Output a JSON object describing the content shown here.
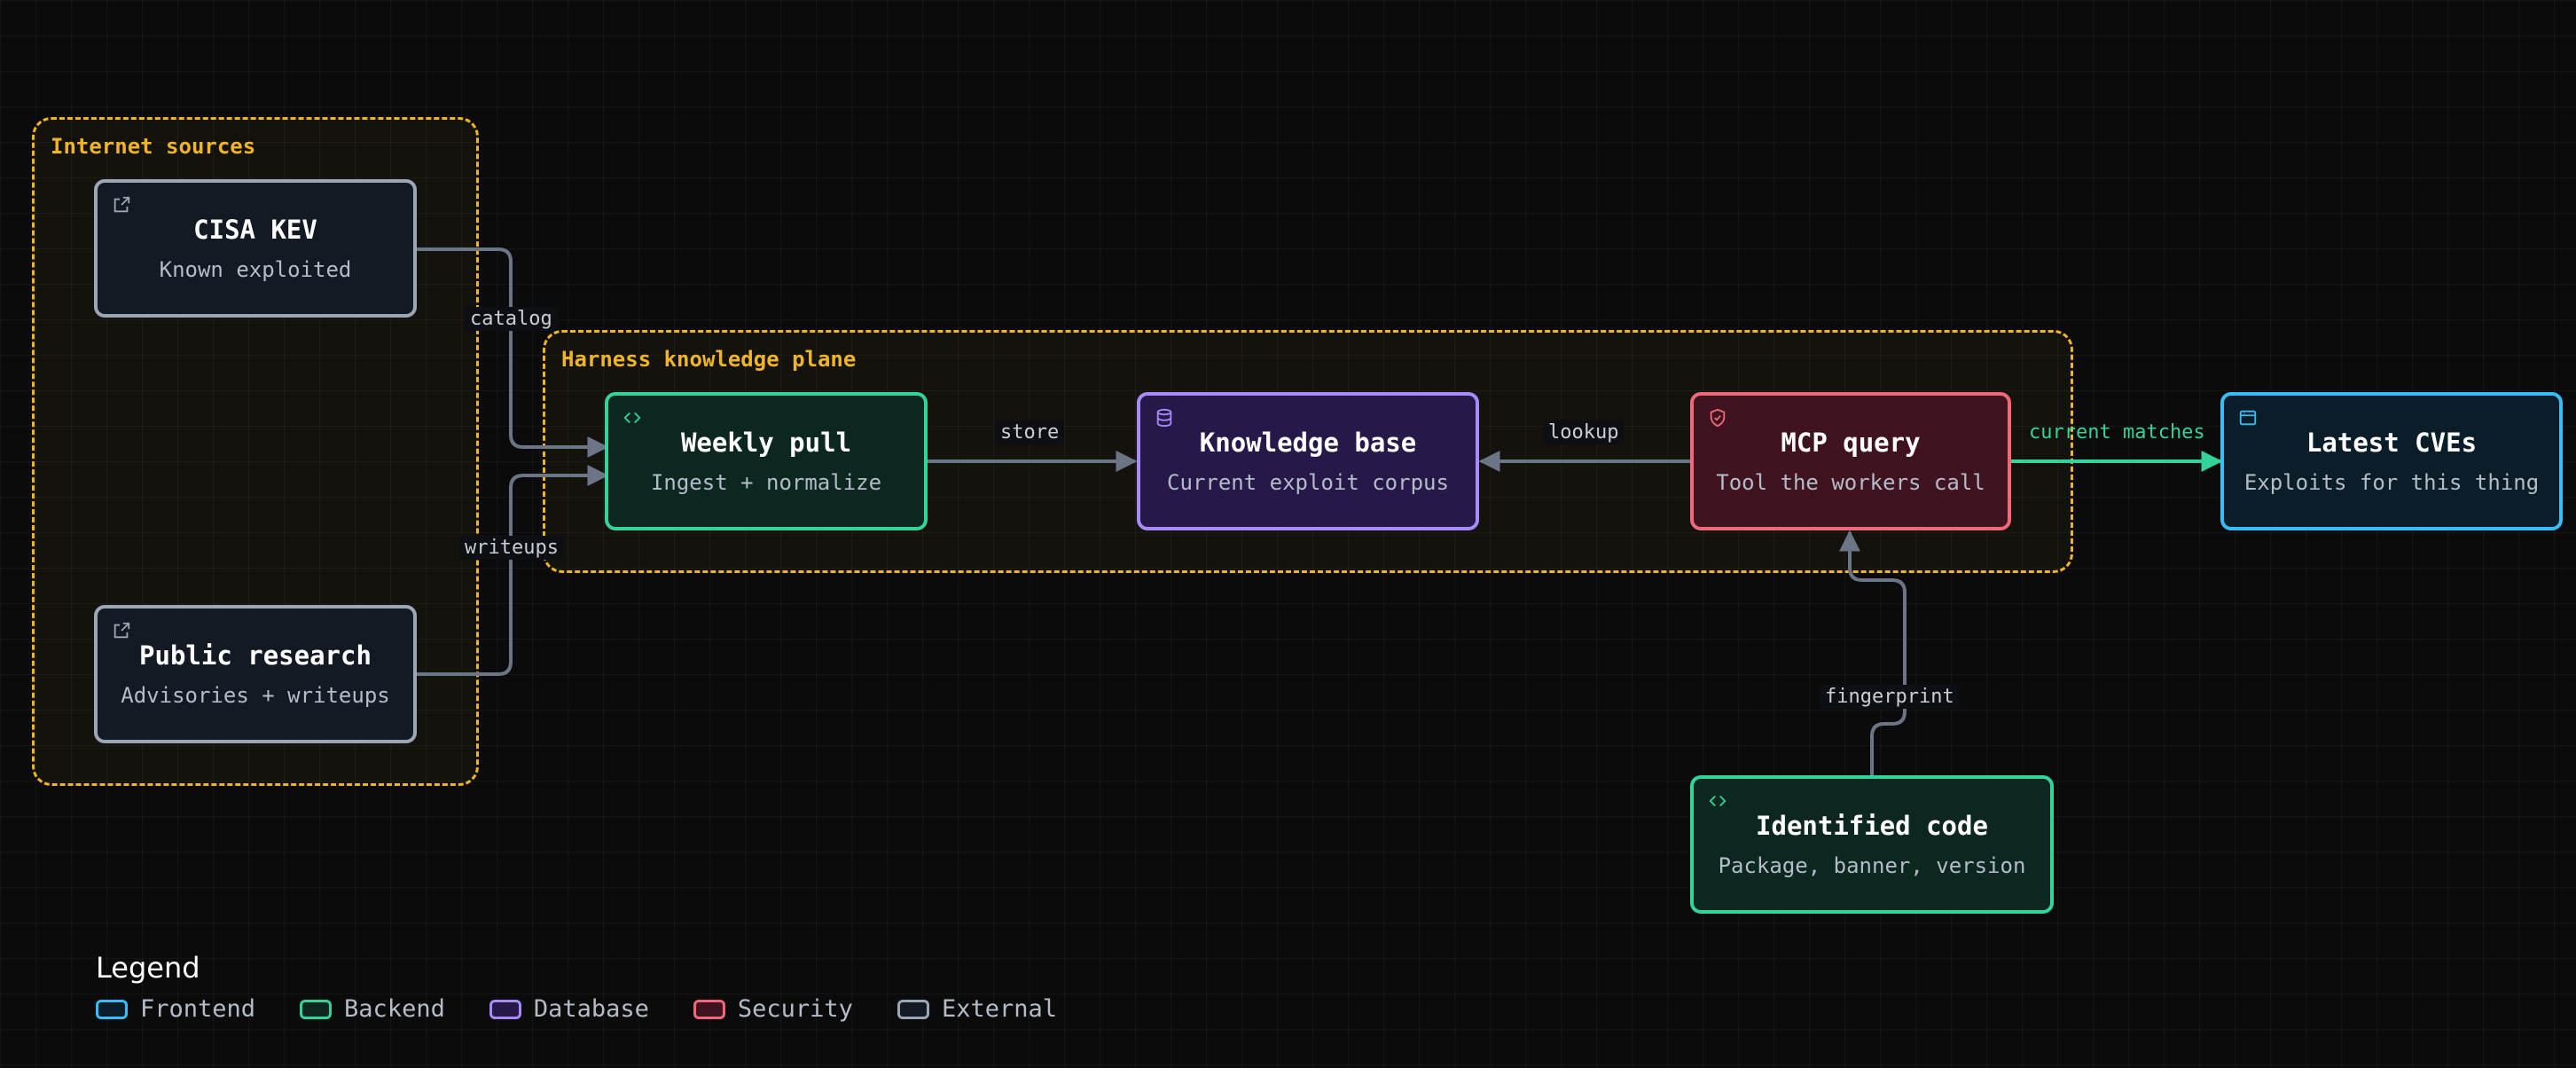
{
  "groups": {
    "internet_sources": {
      "label": "Internet sources"
    },
    "knowledge_plane": {
      "label": "Harness knowledge plane"
    }
  },
  "nodes": {
    "cisa_kev": {
      "title": "CISA KEV",
      "subtitle": "Known exploited",
      "icon": "external-link-icon"
    },
    "public_research": {
      "title": "Public research",
      "subtitle": "Advisories + writeups",
      "icon": "external-link-icon"
    },
    "weekly_pull": {
      "title": "Weekly pull",
      "subtitle": "Ingest + normalize",
      "icon": "code-icon"
    },
    "knowledge_base": {
      "title": "Knowledge base",
      "subtitle": "Current exploit corpus",
      "icon": "database-icon"
    },
    "mcp_query": {
      "title": "MCP query",
      "subtitle": "Tool the workers call",
      "icon": "shield-check-icon"
    },
    "latest_cves": {
      "title": "Latest CVEs",
      "subtitle": "Exploits for this thing",
      "icon": "browser-window-icon"
    },
    "identified_code": {
      "title": "Identified code",
      "subtitle": "Package, banner, version",
      "icon": "code-icon"
    }
  },
  "edges": {
    "catalog": "catalog",
    "writeups": "writeups",
    "store": "store",
    "lookup": "lookup",
    "current_matches": "current matches",
    "fingerprint": "fingerprint"
  },
  "legend": {
    "title": "Legend",
    "items": [
      {
        "label": "Frontend",
        "color": "#38bdf8"
      },
      {
        "label": "Backend",
        "color": "#34d399"
      },
      {
        "label": "Database",
        "color": "#a78bfa"
      },
      {
        "label": "Security",
        "color": "#f0687a"
      },
      {
        "label": "External",
        "color": "#9ca7b6"
      }
    ]
  },
  "colors": {
    "group_border": "#f0b429",
    "edge": "#6b7585",
    "edge_highlight": "#34d399",
    "frontend": "#38bdf8",
    "backend": "#34d399",
    "database": "#a78bfa",
    "security": "#f0687a",
    "external": "#9ca7b6"
  }
}
